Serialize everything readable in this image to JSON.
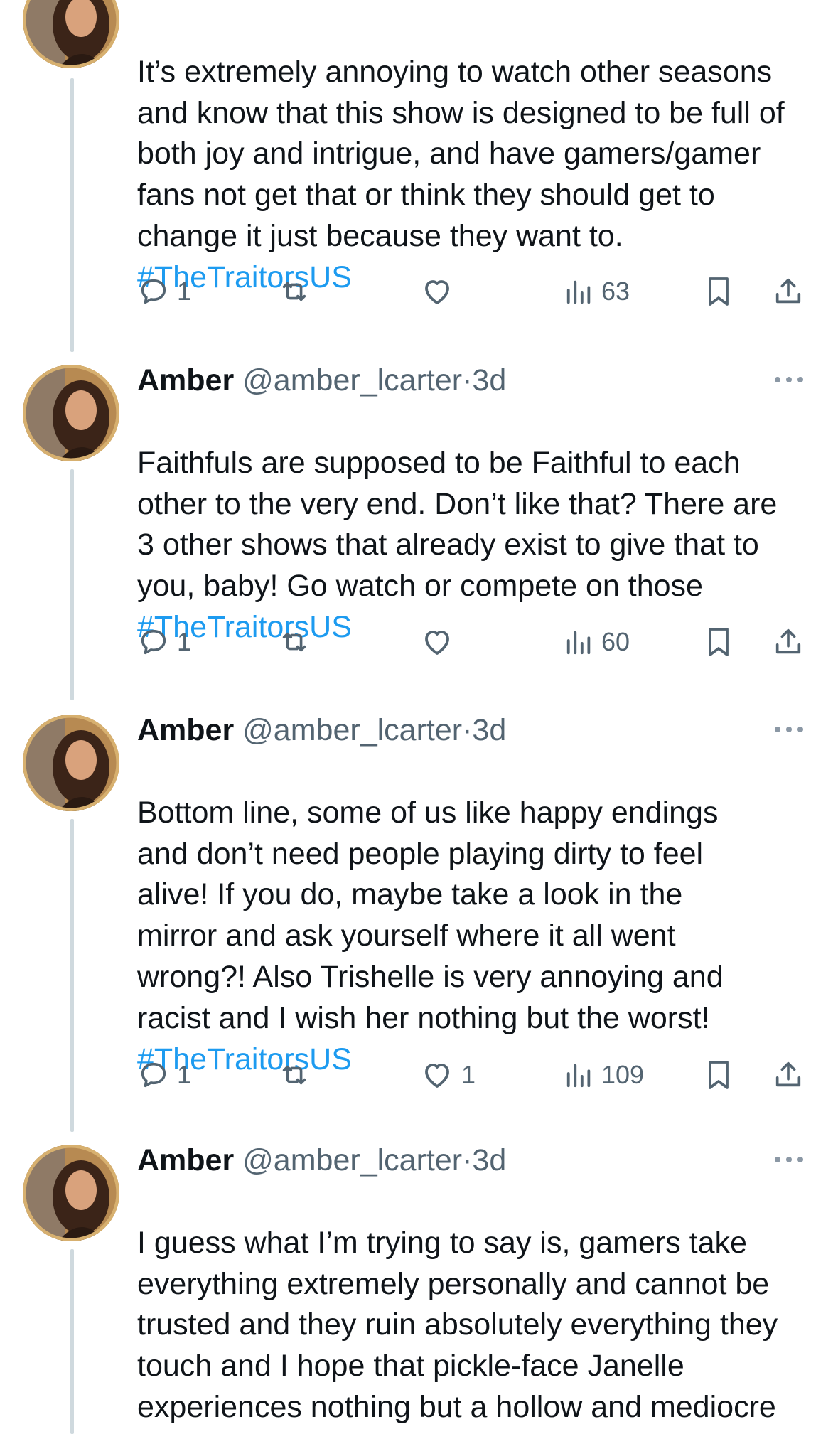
{
  "tweets": [
    {
      "name": "",
      "handle": "",
      "time": "",
      "text": "It’s extremely annoying to watch other seasons and know that this show is designed to be full of both joy and intrigue, and have gamers/gamer fans not get that or think they should get to change it just because they want to.",
      "hashtag": "#TheTraitorsUS",
      "replies": "1",
      "retweets": "",
      "likes": "",
      "views": "63"
    },
    {
      "name": "Amber",
      "handle": "@amber_lcarter",
      "dot": "·",
      "time": "3d",
      "text": "Faithfuls are supposed to be Faithful to each other to the very end. Don’t like that? There are 3 other shows that already exist to give that to you, baby! Go watch or compete on those",
      "hashtag": "#TheTraitorsUS",
      "replies": "1",
      "retweets": "",
      "likes": "",
      "views": "60"
    },
    {
      "name": "Amber",
      "handle": "@amber_lcarter",
      "dot": "·",
      "time": "3d",
      "text": "Bottom line, some of us like happy endings and don’t need people playing dirty to feel alive! If you do, maybe take a look in the mirror and ask yourself where it all went wrong?! Also Trishelle is very annoying and racist and I wish her nothing but the worst!",
      "hashtag": "#TheTraitorsUS",
      "replies": "1",
      "retweets": "",
      "likes": "1",
      "views": "109"
    },
    {
      "name": "Amber",
      "handle": "@amber_lcarter",
      "dot": "·",
      "time": "3d",
      "text": "I guess what I’m trying to say is, gamers take everything extremely personally and cannot be trusted and they ruin absolutely everything they touch and I hope that pickle-face Janelle experiences nothing but a hollow and mediocre home life the rest of her days",
      "hashtag": "",
      "replies": "",
      "retweets": "",
      "likes": "",
      "views": ""
    }
  ],
  "icons": {
    "reply": "reply-icon",
    "retweet": "retweet-icon",
    "like": "heart-icon",
    "views": "views-icon",
    "bookmark": "bookmark-icon",
    "share": "share-icon",
    "more": "more-icon"
  },
  "colors": {
    "text": "#0f1419",
    "secondary": "#536471",
    "hashtag": "#1d9bf0",
    "thread_line": "#cfd9de"
  }
}
